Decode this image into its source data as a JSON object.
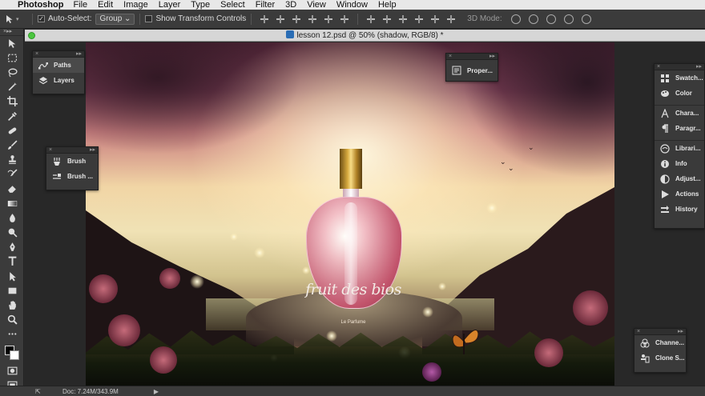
{
  "menubar": {
    "app_name": "Photoshop",
    "items": [
      "File",
      "Edit",
      "Image",
      "Layer",
      "Type",
      "Select",
      "Filter",
      "3D",
      "View",
      "Window",
      "Help"
    ]
  },
  "options_bar": {
    "auto_select_label": "Auto-Select:",
    "auto_select_checked": true,
    "auto_select_mode": "Group",
    "show_transform_label": "Show Transform Controls",
    "three_d_mode_label": "3D Mode:"
  },
  "document": {
    "tab_title": "lesson 12.psd @ 50% (shadow, RGB/8) *",
    "artwork_title": "fruit des bios",
    "artwork_subtitle": "Le Parfume"
  },
  "panels": {
    "paths_layers": [
      {
        "label": "Paths",
        "icon": "paths-icon",
        "active": true
      },
      {
        "label": "Layers",
        "icon": "layers-icon",
        "active": false
      }
    ],
    "brush": [
      {
        "label": "Brush",
        "icon": "brush-icon"
      },
      {
        "label": "Brush ...",
        "icon": "brush-presets-icon"
      }
    ],
    "properties": [
      {
        "label": "Proper...",
        "icon": "properties-icon"
      }
    ],
    "right_dock": [
      {
        "label": "Swatch...",
        "icon": "swatches-icon"
      },
      {
        "label": "Color",
        "icon": "color-icon"
      },
      {
        "label": "Chara...",
        "icon": "character-icon"
      },
      {
        "label": "Paragr...",
        "icon": "paragraph-icon"
      },
      {
        "label": "Librari...",
        "icon": "libraries-icon"
      },
      {
        "label": "Info",
        "icon": "info-icon"
      },
      {
        "label": "Adjust...",
        "icon": "adjustments-icon"
      },
      {
        "label": "Actions",
        "icon": "actions-icon"
      },
      {
        "label": "History",
        "icon": "history-icon"
      }
    ],
    "bottom_right": [
      {
        "label": "Channe...",
        "icon": "channels-icon"
      },
      {
        "label": "Clone S...",
        "icon": "clone-source-icon"
      }
    ]
  },
  "status_bar": {
    "doc_info": "Doc: 7.24M/343.9M"
  },
  "colors": {
    "foreground": "#000000",
    "background": "#ffffff",
    "window_close_green": "#4cc640"
  }
}
